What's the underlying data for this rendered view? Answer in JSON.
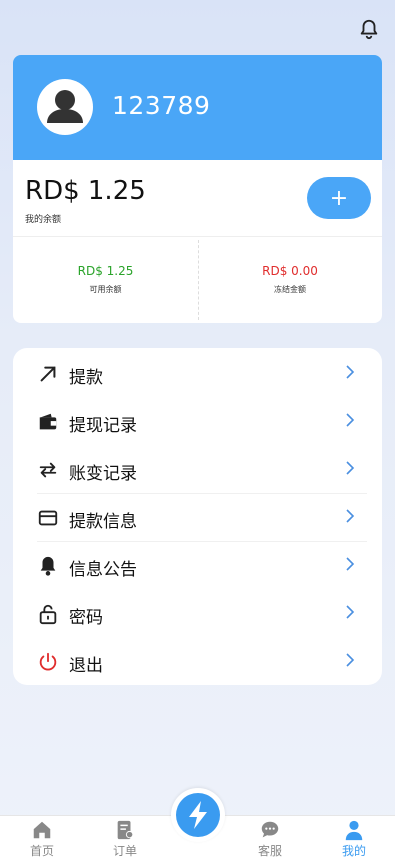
{
  "header": {
    "notification_icon": "bell-icon"
  },
  "profile": {
    "username": "123789",
    "avatar_icon": "user-avatar-icon"
  },
  "balance": {
    "amount": "RD$ 1.25",
    "label": "我的余额",
    "add_label": "+",
    "available_amount": "RD$ 1.25",
    "available_label": "可用余额",
    "frozen_amount": "RD$ 0.00",
    "frozen_label": "冻结金额",
    "available_color": "#2aa32a",
    "frozen_color": "#e02d2d"
  },
  "menu": {
    "items": [
      {
        "label": "提款",
        "icon": "arrow-up-right-icon"
      },
      {
        "label": "提现记录",
        "icon": "wallet-icon"
      },
      {
        "label": "账变记录",
        "icon": "swap-arrows-icon"
      },
      {
        "label": "提款信息",
        "icon": "card-icon"
      },
      {
        "label": "信息公告",
        "icon": "bell-icon"
      },
      {
        "label": "密码",
        "icon": "lock-icon"
      },
      {
        "label": "退出",
        "icon": "power-icon"
      }
    ]
  },
  "tabbar": {
    "home": "首页",
    "orders": "订单",
    "service": "客服",
    "mine": "我的",
    "active": "mine"
  },
  "colors": {
    "accent": "#4aa6f7",
    "logout_icon": "#e02d2d"
  }
}
